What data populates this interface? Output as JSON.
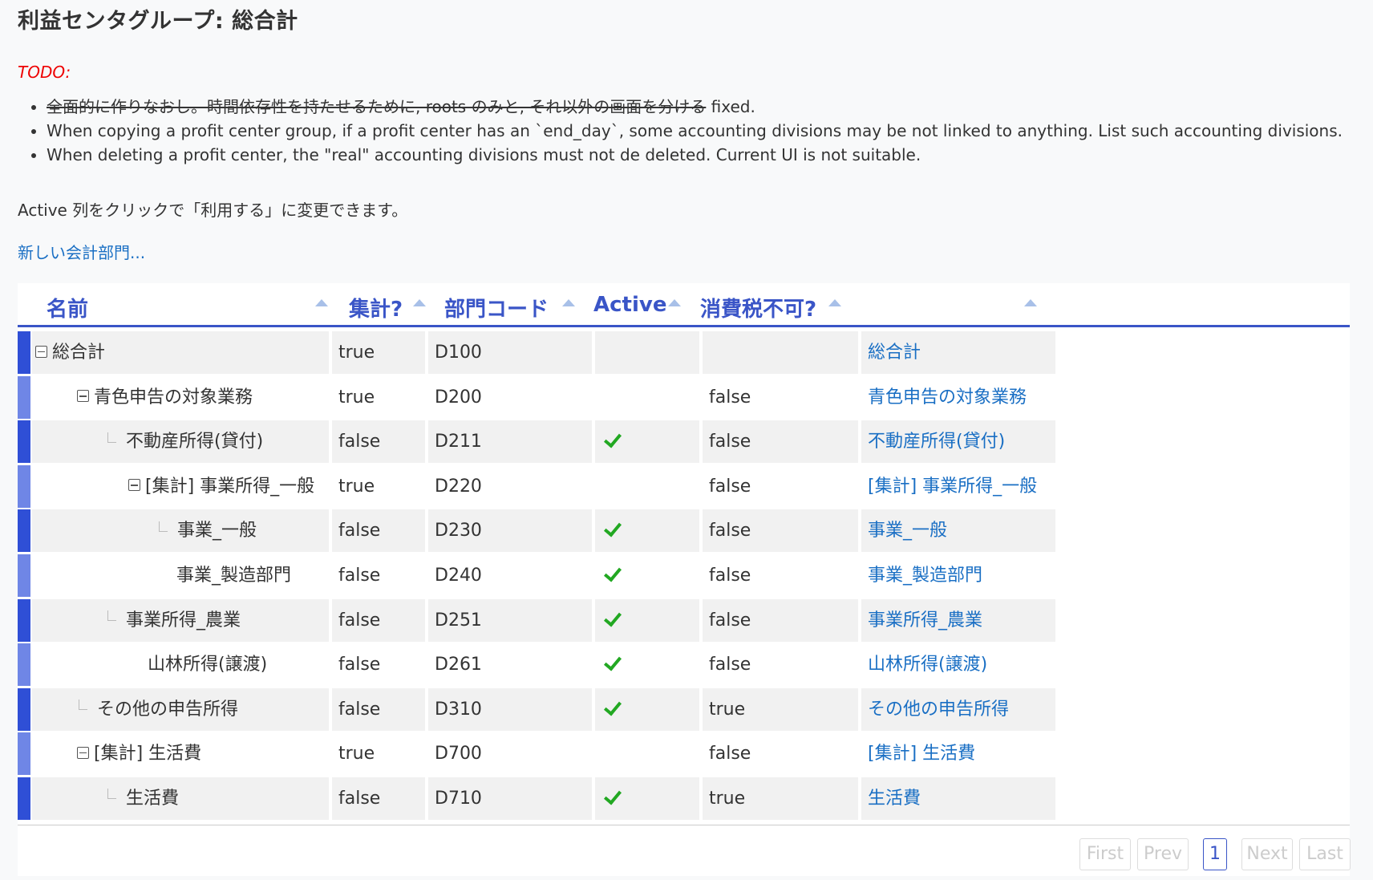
{
  "page": {
    "title": "利益センタグループ: 総合計",
    "todo_label": "TODO:",
    "todo_items": [
      {
        "strike": "全面的に作りなおし。時間依存性を持たせるために, roots のみと, それ以外の画面を分ける",
        "rest": " fixed."
      },
      {
        "strike": "",
        "rest": "When copying a profit center group, if a profit center has an `end_day`, some accounting divisions may be not linked to anything. List such accounting divisions."
      },
      {
        "strike": "",
        "rest": "When deleting a profit center, the \"real\" accounting divisions must not de deleted. Current UI is not suitable."
      }
    ],
    "hint": "Active 列をクリックで「利用する」に変更できます。",
    "new_link": "新しい会計部門..."
  },
  "table": {
    "headers": {
      "name": "名前",
      "sum": "集計?",
      "code": "部門コード",
      "active": "Active",
      "tax": "消費税不可?"
    },
    "rows": [
      {
        "name": "総合計",
        "sum": "true",
        "code": "D100",
        "active": false,
        "tax": "",
        "link": "総合計"
      },
      {
        "name": "青色申告の対象業務",
        "sum": "true",
        "code": "D200",
        "active": false,
        "tax": "false",
        "link": "青色申告の対象業務"
      },
      {
        "name": "不動産所得(貸付)",
        "sum": "false",
        "code": "D211",
        "active": true,
        "tax": "false",
        "link": "不動産所得(貸付)"
      },
      {
        "name": "[集計] 事業所得_一般",
        "sum": "true",
        "code": "D220",
        "active": false,
        "tax": "false",
        "link": "[集計] 事業所得_一般"
      },
      {
        "name": "事業_一般",
        "sum": "false",
        "code": "D230",
        "active": true,
        "tax": "false",
        "link": "事業_一般"
      },
      {
        "name": "事業_製造部門",
        "sum": "false",
        "code": "D240",
        "active": true,
        "tax": "false",
        "link": "事業_製造部門"
      },
      {
        "name": "事業所得_農業",
        "sum": "false",
        "code": "D251",
        "active": true,
        "tax": "false",
        "link": "事業所得_農業"
      },
      {
        "name": "山林所得(譲渡)",
        "sum": "false",
        "code": "D261",
        "active": true,
        "tax": "false",
        "link": "山林所得(譲渡)"
      },
      {
        "name": "その他の申告所得",
        "sum": "false",
        "code": "D310",
        "active": true,
        "tax": "true",
        "link": "その他の申告所得"
      },
      {
        "name": "[集計] 生活費",
        "sum": "true",
        "code": "D700",
        "active": false,
        "tax": "false",
        "link": "[集計] 生活費"
      },
      {
        "name": "生活費",
        "sum": "false",
        "code": "D710",
        "active": true,
        "tax": "true",
        "link": "生活費"
      }
    ]
  },
  "pager": {
    "first": "First",
    "prev": "Prev",
    "current": "1",
    "next": "Next",
    "last": "Last"
  },
  "colors": {
    "accent": "#3a55c7",
    "link": "#1a6fc4",
    "check": "#22a822",
    "todo": "#e00000"
  }
}
